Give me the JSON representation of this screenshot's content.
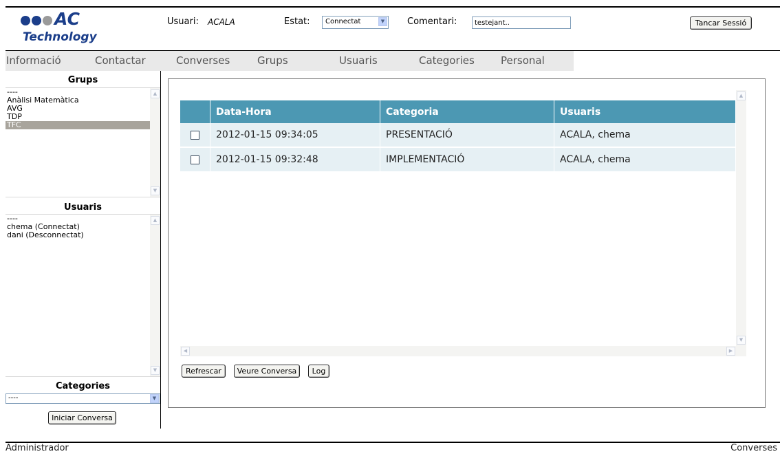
{
  "logo": {
    "brand": "AC",
    "subtitle": "Technology"
  },
  "header": {
    "user_label": "Usuari:",
    "user_value": "ACALA",
    "status_label": "Estat:",
    "status_value": "Connectat",
    "comment_label": "Comentari:",
    "comment_value": "testejant..",
    "logout_label": "Tancar Sessió"
  },
  "menu": {
    "items": [
      "Informació",
      "Contactar",
      "Converses",
      "Grups",
      "Usuaris",
      "Categories",
      "Personal"
    ]
  },
  "sidebar": {
    "groups_title": "Grups",
    "groups": [
      "----",
      "Anàlisi Matemàtica",
      "AVG",
      "TDP",
      "TFC"
    ],
    "groups_selected": "TFC",
    "users_title": "Usuaris",
    "users": [
      "----",
      "chema (Connectat)",
      "dani (Desconnectat)"
    ],
    "categories_title": "Categories",
    "category_value": "----",
    "start_button": "Iniciar Conversa"
  },
  "grid": {
    "columns": [
      "Data-Hora",
      "Categoria",
      "Usuaris"
    ],
    "rows": [
      {
        "datetime": "2012-01-15 09:34:05",
        "category": "PRESENTACIÓ",
        "users": "ACALA, chema"
      },
      {
        "datetime": "2012-01-15 09:32:48",
        "category": "IMPLEMENTACIÓ",
        "users": "ACALA, chema"
      }
    ]
  },
  "actions": {
    "refresh": "Refrescar",
    "view": "Veure Conversa",
    "log": "Log"
  },
  "footer": {
    "left": "Administrador",
    "right": "Converses"
  },
  "colors": {
    "brand": "#1b3e8a",
    "grid_header": "#4c98b3",
    "grid_row": "#e6f0f4",
    "selection": "#a8a49c"
  },
  "icons": {
    "dropdown": "chevron-down-icon",
    "scroll_up": "scroll-up-icon",
    "scroll_down": "scroll-down-icon",
    "scroll_left": "scroll-left-icon",
    "scroll_right": "scroll-right-icon"
  }
}
